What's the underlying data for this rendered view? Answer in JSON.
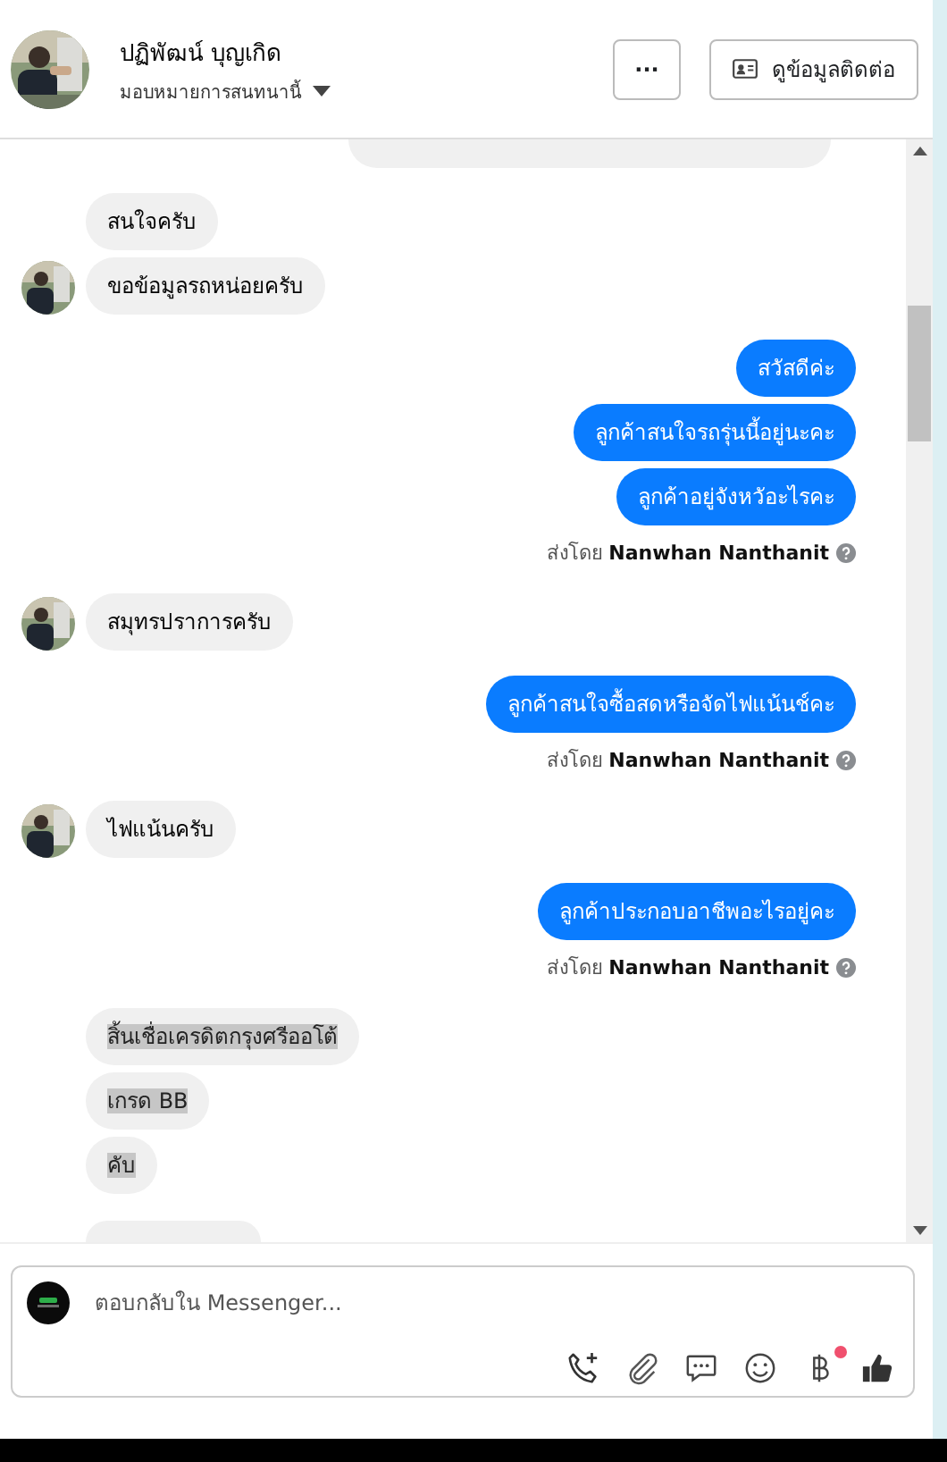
{
  "header": {
    "name": "ปฏิพัฒน์ บุญเกิด",
    "assign": "มอบหมายการสนทนานี้",
    "more_button": "···",
    "contact_button": "ดูข้อมูลติดต่อ"
  },
  "groups": [
    {
      "kind": "incoming",
      "avatar": true,
      "bubbles": [
        {
          "text": "สนใจครับ",
          "highlighted": false
        },
        {
          "text": "ขอข้อมูลรถหน่อยครับ",
          "highlighted": false
        }
      ]
    },
    {
      "kind": "outgoing",
      "sent_by_label": "ส่งโดย",
      "sender": "Nanwhan Nanthanit",
      "bubbles": [
        {
          "text": "สวัสดีค่ะ",
          "highlighted": false
        },
        {
          "text": "ลูกค้าสนใจรถรุ่นนี้อยู่นะคะ",
          "highlighted": false
        },
        {
          "text": "ลูกค้าอยู่จังหวัอะไรคะ",
          "highlighted": false
        }
      ]
    },
    {
      "kind": "incoming",
      "avatar": true,
      "bubbles": [
        {
          "text": "สมุทรปราการครับ",
          "highlighted": false
        }
      ]
    },
    {
      "kind": "outgoing",
      "sent_by_label": "ส่งโดย",
      "sender": "Nanwhan Nanthanit",
      "bubbles": [
        {
          "text": "ลูกค้าสนใจซื้อสดหรือจัดไฟแน้นช์คะ",
          "highlighted": false
        }
      ]
    },
    {
      "kind": "incoming",
      "avatar": true,
      "bubbles": [
        {
          "text": "ไฟแน้นครับ",
          "highlighted": false
        }
      ]
    },
    {
      "kind": "outgoing",
      "sent_by_label": "ส่งโดย",
      "sender": "Nanwhan Nanthanit",
      "bubbles": [
        {
          "text": "ลูกค้าประกอบอาชีพอะไรอยู่คะ",
          "highlighted": false
        }
      ]
    },
    {
      "kind": "incoming",
      "avatar": false,
      "bubbles": [
        {
          "text": "สิ้นเชื่อเครดิตกรุงศรีออโต้",
          "highlighted": true
        },
        {
          "text": "เกรด BB",
          "highlighted": true
        },
        {
          "text": "คับ",
          "highlighted": true
        }
      ]
    }
  ],
  "composer": {
    "placeholder": "ตอบกลับใน Messenger...",
    "payment_badge": true
  }
}
